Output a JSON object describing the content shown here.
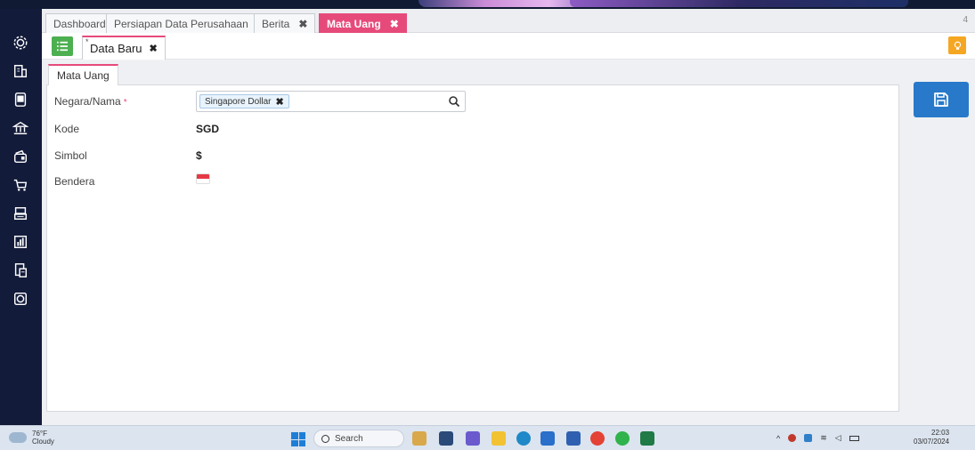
{
  "tabs": [
    {
      "label": "Dashboard",
      "closable": false
    },
    {
      "label": "Persiapan Data Perusahaan",
      "closable": false
    },
    {
      "label": "Berita",
      "closable": true
    },
    {
      "label": "Mata Uang",
      "closable": true,
      "active": true
    }
  ],
  "tab_count": "4",
  "subtab": {
    "label": "Data Baru",
    "modified_marker": "*"
  },
  "form": {
    "tab_label": "Mata Uang",
    "fields": {
      "negara_label": "Negara/Nama",
      "negara_required": "*",
      "negara_value": "Singapore Dollar",
      "kode_label": "Kode",
      "kode_value": "SGD",
      "simbol_label": "Simbol",
      "simbol_value": "$",
      "bendera_label": "Bendera"
    }
  },
  "colors": {
    "accent": "#e64a7b",
    "sidebar": "#131b3a",
    "save_button": "#2879c9",
    "menu_button": "#4caf50",
    "bulb_button": "#f5a623"
  },
  "taskbar": {
    "weather_temp": "76°F",
    "weather_desc": "Cloudy",
    "search_label": "Search",
    "time": "22:03",
    "date": "03/07/2024"
  }
}
